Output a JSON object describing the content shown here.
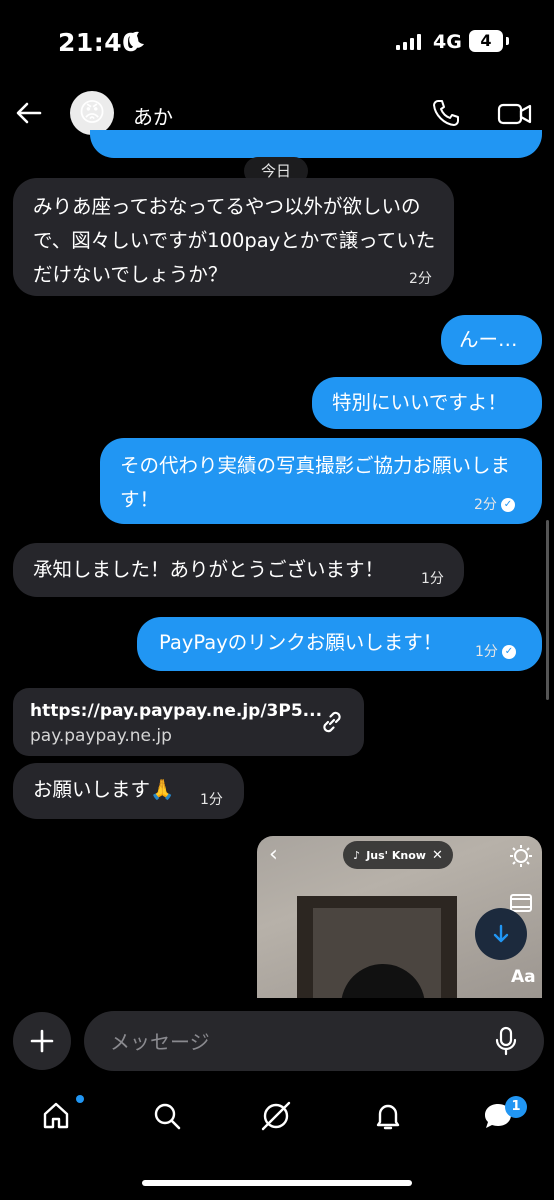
{
  "status": {
    "time": "21:40",
    "network": "4G",
    "battery": "4"
  },
  "header": {
    "name": "あか",
    "avatar_emoji": "😡"
  },
  "divider": {
    "label": "今日"
  },
  "messages": [
    {
      "side": "in",
      "text": "みりあ座っておなってるやつ以外が欲しいので、図々しいですが100payとかで譲っていただけないでしょうか？",
      "time": "2分"
    },
    {
      "side": "out",
      "text": "んー…"
    },
    {
      "side": "out",
      "text": "特別にいいですよ！"
    },
    {
      "side": "out",
      "text": "その代わり実績の写真撮影ご協力お願いします！",
      "time": "2分",
      "read": true
    },
    {
      "side": "in",
      "text": "承知しました！ありがとうございます！",
      "time": "1分"
    },
    {
      "side": "out",
      "text": "PayPayのリンクお願いします！",
      "time": "1分",
      "read": true
    },
    {
      "side": "in",
      "text": "お願いします🙏",
      "time": "1分"
    }
  ],
  "link": {
    "url": "https://pay.paypay.ne.jp/3P5...",
    "domain": "pay.paypay.ne.jp"
  },
  "video": {
    "music_label": "Jus' Know",
    "text_tool": "Aa"
  },
  "composer": {
    "placeholder": "メッセージ"
  },
  "nav": {
    "messages_badge": "1"
  },
  "colors": {
    "outgoing": "#2196f3",
    "incoming": "#26262b",
    "background": "#000000"
  }
}
